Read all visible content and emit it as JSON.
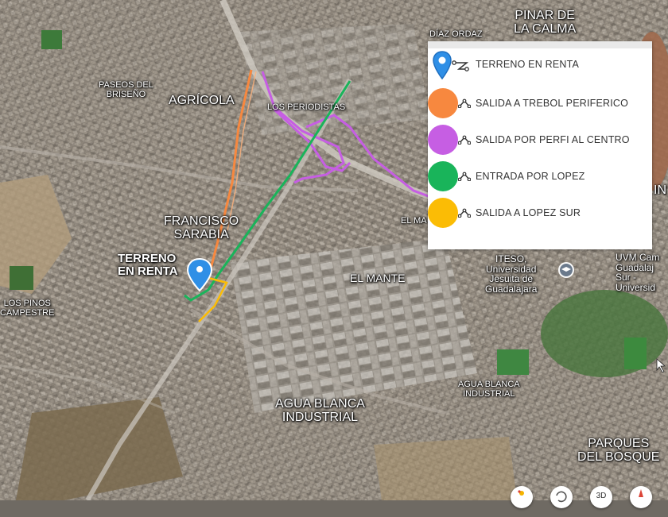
{
  "map": {
    "place_labels": [
      {
        "id": "pinar-de-la-calma",
        "text": "PINAR DE\nLA CALMA"
      },
      {
        "id": "diaz-ordaz",
        "text": "DÍAZ ORDAZ"
      },
      {
        "id": "paseos-del-briseno",
        "text": "PASEOS DEL\nBRISEÑO"
      },
      {
        "id": "agricola",
        "text": "AGRÍCOLA"
      },
      {
        "id": "los-periodistas",
        "text": "LOS PERIODISTAS"
      },
      {
        "id": "francisco-sarabia",
        "text": "FRANCISCO\nSARABIA"
      },
      {
        "id": "el-mante-small",
        "text": "EL MA"
      },
      {
        "id": "el-mante",
        "text": "EL MANTE"
      },
      {
        "id": "iteso",
        "text": "ITESO,\nUniversidad\nJesuita de\nGuadalajara"
      },
      {
        "id": "uvm",
        "text": "UVM Cam\nGuadalaj\nSur - \nUniversid"
      },
      {
        "id": "in-edge",
        "text": "IN"
      },
      {
        "id": "los-pinos-campestre",
        "text": "LOS PINOS\nCAMPESTRE"
      },
      {
        "id": "agua-blanca-industrial-small",
        "text": "AGUA BLANCA\nINDUSTRIAL"
      },
      {
        "id": "agua-blanca-industrial",
        "text": "AGUA BLANCA\nINDUSTRIAL"
      },
      {
        "id": "parques-del-bosque",
        "text": "PARQUES\nDEL BOSQUE"
      }
    ],
    "pin_label": "TERRENO\nEN RENTA",
    "pin_color": "#2f8fe6"
  },
  "legend": {
    "items": [
      {
        "label": "TERRENO EN RENTA",
        "color": "#2f8fe6",
        "icon": "pin-icon"
      },
      {
        "label": "SALIDA A TREBOL PERIFERICO",
        "color": "#f7883f",
        "icon": "circle-icon"
      },
      {
        "label": "SALIDA POR PERFI AL CENTRO",
        "color": "#c65ee3",
        "icon": "circle-icon"
      },
      {
        "label": "ENTRADA POR LOPEZ",
        "color": "#19b45a",
        "icon": "circle-icon"
      },
      {
        "label": "SALIDA A LOPEZ SUR",
        "color": "#fbbc05",
        "icon": "circle-icon"
      }
    ]
  },
  "controls": {
    "view_3d_label": "3D"
  },
  "colors": {
    "route_orange": "#f7883f",
    "route_purple": "#c65ee3",
    "route_green": "#19b45a",
    "route_yellow": "#fbbc05"
  }
}
